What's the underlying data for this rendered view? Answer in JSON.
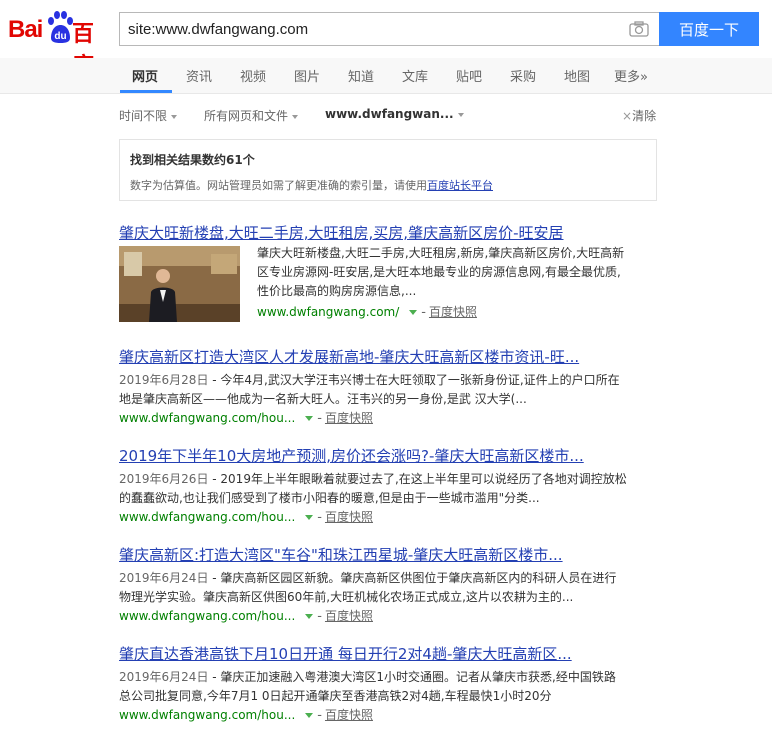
{
  "logo": {
    "text_left": "Bai",
    "text_right": "百度",
    "paw_text": "du"
  },
  "search": {
    "query": "site:www.dwfangwang.com",
    "button_label": "百度一下"
  },
  "tabs": [
    {
      "label": "网页",
      "active": true
    },
    {
      "label": "资讯"
    },
    {
      "label": "视频"
    },
    {
      "label": "图片"
    },
    {
      "label": "知道"
    },
    {
      "label": "文库"
    },
    {
      "label": "贴吧"
    },
    {
      "label": "采购"
    },
    {
      "label": "地图"
    },
    {
      "label": "更多»"
    }
  ],
  "filters": {
    "time": "时间不限",
    "filetype": "所有网页和文件",
    "site": "www.dwfangwan...",
    "clear": "清除"
  },
  "info_box": {
    "title": "找到相关结果数约61个",
    "desc": "数字为估算值。网站管理员如需了解更准确的索引量，请使用",
    "link": "百度站长平台"
  },
  "results": [
    {
      "title": "肇庆大旺新楼盘,大旺二手房,大旺租房,买房,肇庆高新区房价-旺安居",
      "abstract_lines": [
        "肇庆大旺新楼盘,大旺二手房,大旺租房,新房,肇庆高新区房价,大旺高新",
        "区专业房源网-旺安居,是大旺本地最专业的房源信息网,有最全最优质,",
        "性价比最高的购房房源信息,..."
      ],
      "url": "www.dwfangwang.com/",
      "snapshot": "百度快照"
    },
    {
      "title": "肇庆高新区打造大湾区人才发展新高地-肇庆大旺高新区楼市资讯-旺...",
      "date": "2019年6月28日",
      "abstract_lines": [
        " - 今年4月,武汉大学汪韦兴博士在大旺领取了一张新身份证,证件上的户口所在",
        "地是肇庆高新区——他成为一名新大旺人。汪韦兴的另一身份,是武 汉大学(..."
      ],
      "url": "www.dwfangwang.com/hou...",
      "snapshot": "百度快照"
    },
    {
      "title": "2019年下半年10大房地产预测,房价还会涨吗?-肇庆大旺高新区楼市...",
      "date": "2019年6月26日",
      "abstract_lines": [
        " - 2019年上半年眼瞅着就要过去了,在这上半年里可以说经历了各地对调控放松",
        "的蠢蠢欲动,也让我们感受到了楼市小阳春的暖意,但是由于一些城市滥用\"分类..."
      ],
      "url": "www.dwfangwang.com/hou...",
      "snapshot": "百度快照"
    },
    {
      "title": "肇庆高新区:打造大湾区\"车谷\"和珠江西星城-肇庆大旺高新区楼市...",
      "date": "2019年6月24日",
      "abstract_lines": [
        " - 肇庆高新区园区新貌。肇庆高新区供图位于肇庆高新区内的科研人员在进行",
        "物理光学实验。肇庆高新区供图60年前,大旺机械化农场正式成立,这片以农耕为主的..."
      ],
      "url": "www.dwfangwang.com/hou...",
      "snapshot": "百度快照"
    },
    {
      "title": "肇庆直达香港高铁下月10日开通 每日开行2对4趟-肇庆大旺高新区...",
      "date": "2019年6月24日",
      "abstract_lines": [
        " - 肇庆正加速融入粤港澳大湾区1小时交通圈。记者从肇庆市获悉,经中国铁路",
        "总公司批复同意,今年7月1 0日起开通肇庆至香港高铁2对4趟,车程最快1小时20分"
      ],
      "url": "www.dwfangwang.com/hou...",
      "snapshot": "百度快照"
    }
  ]
}
